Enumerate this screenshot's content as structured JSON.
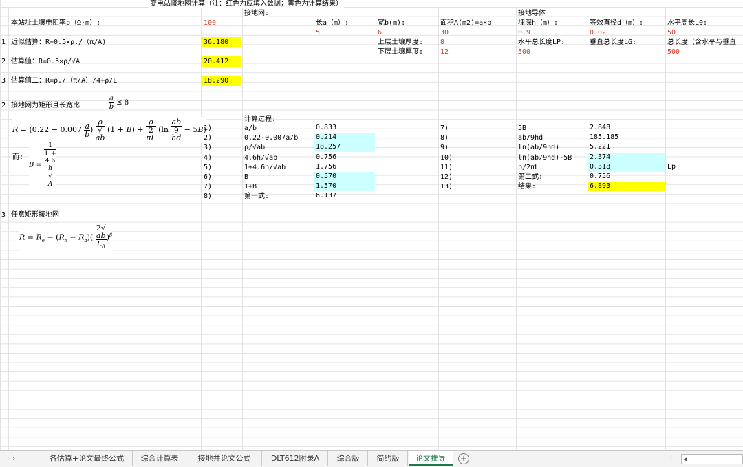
{
  "title": "变电站接地网计算（注：红色为应填入数据；黄色为计算结果）",
  "header": {
    "grid_label": "接地网:",
    "conductor_label": "接地导体",
    "soil_resistivity_label": "本站址土壤电阻率ρ（Ω·m）:",
    "soil_resistivity_value": "100",
    "length_label": "长a（m）:",
    "length_value": "5",
    "width_label": "宽b(m):",
    "width_value": "6",
    "area_label": "面积A(m2)=a×b",
    "area_value": "30",
    "depth_label": "埋深h（m）:",
    "depth_value": "0.9",
    "diameter_label": "等效直径d（m）:",
    "diameter_value": "0.02",
    "perimeter_label": "水平周长L0:",
    "perimeter_value": "50",
    "upper_soil_label": "上层土壤厚度:",
    "upper_soil_value": "8",
    "lower_soil_label": "下层土壤厚度:",
    "lower_soil_value": "12",
    "horiz_total_label": "水平总长度LP:",
    "horiz_total_value": "500",
    "vert_total_label": "垂直总长度LG:",
    "total_length_label": "总长度（含水平与垂直",
    "total_length_value": "500"
  },
  "estimates": [
    {
      "num": "1",
      "label": "近似估算：R=0.5×ρ./（π/A)",
      "value": "36.180"
    },
    {
      "num": "2",
      "label": "估算值：R=0.5×ρ/√A",
      "value": "20.412"
    },
    {
      "num": "3",
      "label": "估算值二：R=ρ./（π/A）/4+ρ/L",
      "value": "18.290"
    }
  ],
  "section2": {
    "num": "2",
    "label": "接地网为矩形且长宽比",
    "cond_lhs_num": "a",
    "cond_lhs_den": "b",
    "cond_rhs": "≤ 8",
    "er_label": "而:"
  },
  "section3": {
    "num": "3",
    "label": "任意矩形接地网"
  },
  "calc": {
    "title": "计算过程:",
    "left_rows": [
      {
        "step": "1)",
        "expr": "a/b",
        "value": "0.833",
        "hl": ""
      },
      {
        "step": "2)",
        "expr": "0.22-0.007a/b",
        "value": "0.214",
        "hl": "cyan"
      },
      {
        "step": "3)",
        "expr": "ρ/√ab",
        "value": "18.257",
        "hl": "cyan"
      },
      {
        "step": "4)",
        "expr": "4.6h/√ab",
        "value": "0.756",
        "hl": ""
      },
      {
        "step": "5)",
        "expr": "1+4.6h/√ab",
        "value": "1.756",
        "hl": ""
      },
      {
        "step": "6)",
        "expr": "B",
        "value": "0.570",
        "hl": "cyan"
      },
      {
        "step": "7)",
        "expr": "1+B",
        "value": "1.570",
        "hl": "cyan"
      },
      {
        "step": "8)",
        "expr": "第一式:",
        "value": "6.137",
        "hl": ""
      }
    ],
    "right_rows": [
      {
        "step": "7)",
        "expr": "5B",
        "value": "2.848",
        "hl": ""
      },
      {
        "step": "8)",
        "expr": "ab/9hd",
        "value": "185.185",
        "hl": ""
      },
      {
        "step": "9)",
        "expr": "ln(ab/9hd)",
        "value": "5.221",
        "hl": ""
      },
      {
        "step": "10)",
        "expr": "ln(ab/9hd)-5B",
        "value": "2.374",
        "hl": "cyan"
      },
      {
        "step": "11)",
        "expr": "ρ/2πL",
        "value": "0.318",
        "hl": "cyan"
      },
      {
        "step": "12)",
        "expr": "第二式:",
        "value": "0.756",
        "hl": ""
      },
      {
        "step": "13)",
        "expr": "结果:",
        "value": "6.893",
        "hl": "yel"
      }
    ],
    "lp_label": "Lp"
  },
  "tabs": [
    {
      "label": "各估算+论文最终公式",
      "active": false
    },
    {
      "label": "综合计算表",
      "active": false
    },
    {
      "label": "接地井论文公式",
      "active": false
    },
    {
      "label": "DLT612附录A",
      "active": false
    },
    {
      "label": "综合版",
      "active": false
    },
    {
      "label": "简约版",
      "active": false
    },
    {
      "label": "论文推导",
      "active": true
    }
  ],
  "colors": {
    "input_red": "#d23b2a",
    "result_yellow": "#ffff00",
    "calc_cyan": "#ccffff",
    "active_tab": "#1d7a47"
  }
}
